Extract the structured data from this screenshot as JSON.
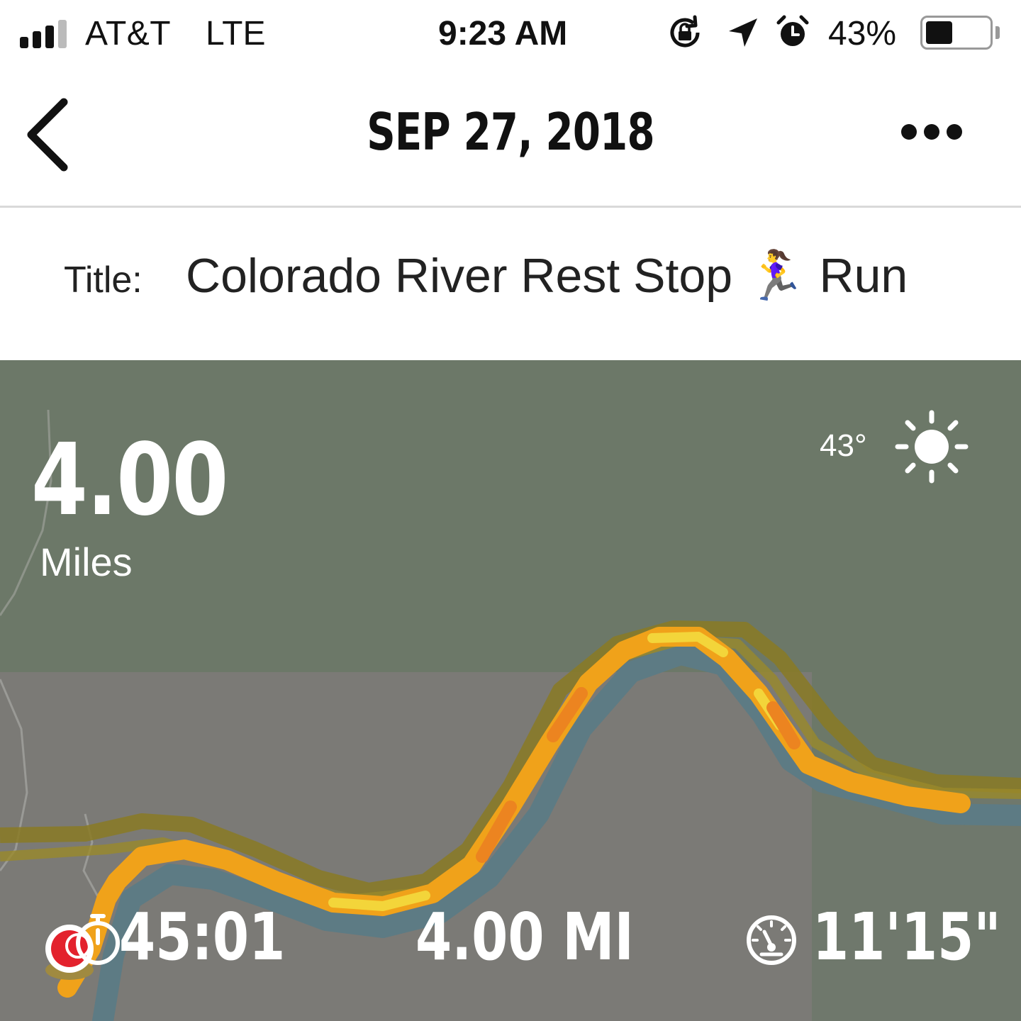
{
  "status_bar": {
    "carrier": "AT&T",
    "network": "LTE",
    "time": "9:23 AM",
    "battery_percent": "43%",
    "battery_level": 0.43,
    "signal_bars_filled": 3,
    "icons": [
      "orientation-lock-icon",
      "location-arrow-icon",
      "alarm-icon"
    ]
  },
  "header": {
    "date": "SEP 27, 2018",
    "back_icon": "chevron-left-icon",
    "more_icon": "more-icon"
  },
  "activity": {
    "title_label": "Title:",
    "title": "Colorado River Rest Stop 🏃‍♀️ Run"
  },
  "map": {
    "distance_value": "4.00",
    "distance_unit": "Miles",
    "temperature": "43°",
    "weather_icon": "sun-icon",
    "colors": {
      "map_green": "#6c7868",
      "map_gray": "#7b7a76",
      "river": "#5d7b84",
      "route_orange": "#f0a21a",
      "route_yellow": "#f3d53a"
    }
  },
  "stats": {
    "duration": "45:01",
    "distance": "4.00 MI",
    "pace": "11'15\"",
    "duration_icon": "stopwatch-icon",
    "pace_icon": "speedometer-icon"
  }
}
